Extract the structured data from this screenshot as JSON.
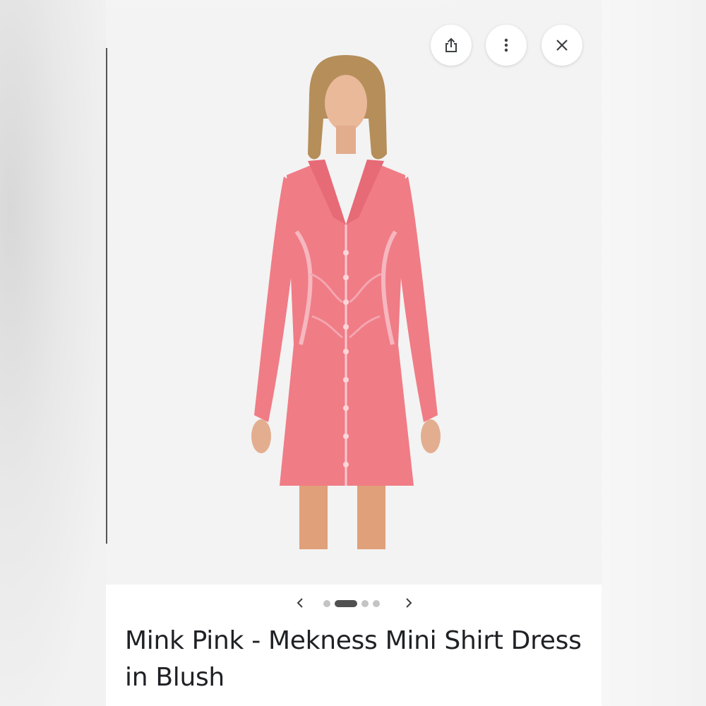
{
  "actions": {
    "share_icon": "share-icon",
    "more_icon": "more-vert-icon",
    "close_icon": "close-icon"
  },
  "pager": {
    "prev_icon": "chevron-left-icon",
    "next_icon": "chevron-right-icon",
    "dots": [
      {
        "active": false
      },
      {
        "active": true
      },
      {
        "active": false
      },
      {
        "active": false
      }
    ]
  },
  "product": {
    "title": "Mink Pink - Mekness Mini Shirt Dress in Blush",
    "image_icon": "product-photo"
  },
  "colors": {
    "dress": "#f07c86",
    "background": "#f3f3f3",
    "text": "#202124",
    "active_dot": "#505050",
    "inactive_dot": "#c4c4c4"
  }
}
